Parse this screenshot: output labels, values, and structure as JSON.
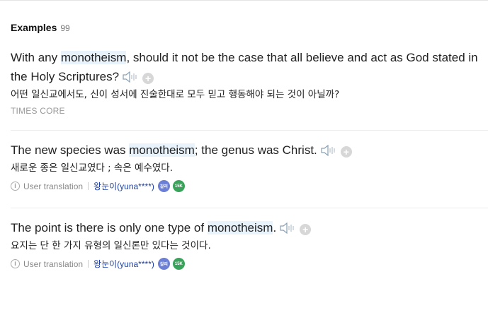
{
  "header": {
    "title": "Examples",
    "count": "99"
  },
  "examples": [
    {
      "en_before": "With any ",
      "en_highlight": "monotheism",
      "en_after": ", should it not be the case that all believe and act as God stated in the Holy Scriptures?",
      "ko": "어떤 일신교에서도, 신이 성서에 진술한대로 모두 믿고 행동해야 되는 것이 아닐까?",
      "source": "TIMES CORE"
    },
    {
      "en_before": "The new species was ",
      "en_highlight": "monotheism",
      "en_after": "; the genus was Christ.",
      "ko": "새로운 종은 일신교였다 ; 속은 예수였다.",
      "meta": {
        "label": "User translation",
        "user": "왕눈이(yuna****)",
        "badge1": "갈리",
        "badge2": "15K"
      }
    },
    {
      "en_before": "The point is there is only one type of ",
      "en_highlight": "monotheism",
      "en_after": ".",
      "ko": "요지는 단 한 가지 유형의 일신론만 있다는 것이다.",
      "meta": {
        "label": "User translation",
        "user": "왕눈이(yuna****)",
        "badge1": "갈리",
        "badge2": "15K"
      }
    }
  ],
  "icons": {
    "speaker": "speaker-icon",
    "add": "plus-circle-icon",
    "info": "info-icon"
  },
  "colors": {
    "highlight": "#e8f3fb",
    "user_link": "#1a3ea8",
    "badge_blue": "#6b7fd6",
    "badge_green": "#3aa35b"
  }
}
